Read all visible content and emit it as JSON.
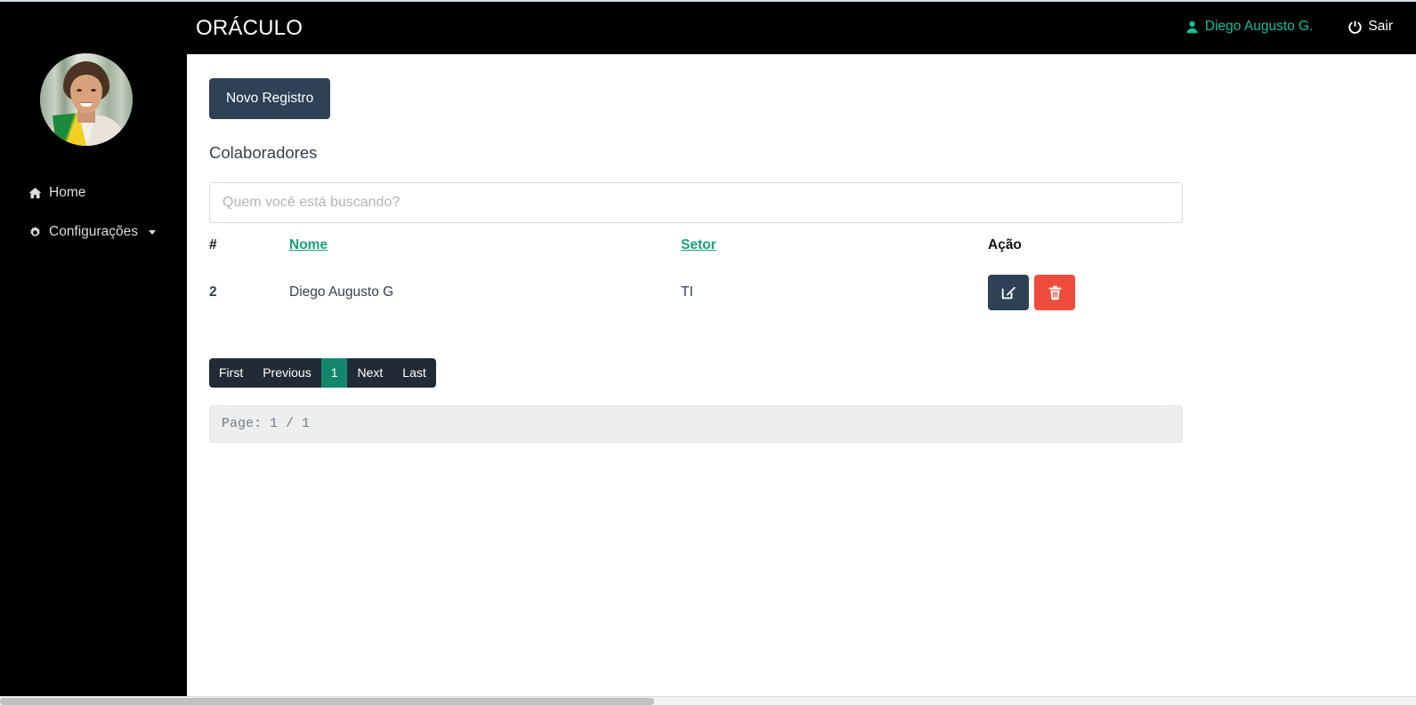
{
  "topbar": {
    "brand": "ORÁCULO",
    "user_label": "Diego Augusto G.",
    "user_icon": "user-icon",
    "logout_label": "Sair",
    "logout_icon": "power-icon",
    "background": "#000000",
    "user_color": "#1abc9c"
  },
  "sidebar": {
    "avatar_name": "avatar",
    "items": [
      {
        "label": "Home",
        "icon": "home-icon",
        "has_caret": false
      },
      {
        "label": "Configurações",
        "icon": "gear-icon",
        "has_caret": true
      }
    ]
  },
  "main": {
    "new_record_button": "Novo Registro",
    "page_title": "Colaboradores",
    "search": {
      "placeholder": "Quem você está buscando?",
      "value": ""
    },
    "table": {
      "headers": {
        "hash": "#",
        "nome": "Nome",
        "setor": "Setor",
        "acao": "Ação"
      },
      "rows": [
        {
          "hash": "2",
          "nome": "Diego Augusto G",
          "setor": "TI",
          "edit_icon": "edit-pencil-icon",
          "delete_icon": "trash-icon"
        }
      ]
    },
    "pagination": {
      "first": "First",
      "previous": "Previous",
      "current": "1",
      "next": "Next",
      "last": "Last",
      "active_color": "#13876b",
      "background": "#212b36"
    },
    "page_indicator": "Page: 1 / 1"
  },
  "colors": {
    "primary_dark": "#2f4154",
    "danger": "#ef4d3c",
    "link_teal": "#18a07d"
  }
}
